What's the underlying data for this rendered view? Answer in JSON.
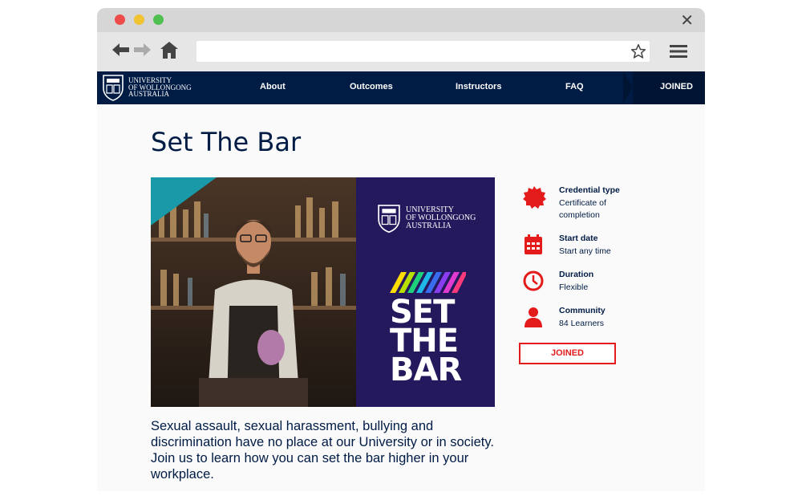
{
  "browser": {
    "url": ""
  },
  "site": {
    "logo_text": [
      "UNIVERSITY",
      "OF WOLLONGONG",
      "AUSTRALIA"
    ],
    "nav": [
      "About",
      "Outcomes",
      "Instructors",
      "FAQ"
    ],
    "joined_tab": "JOINED"
  },
  "course": {
    "title": "Set The Bar",
    "hero_logo_text": [
      "UNIVERSITY",
      "OF WOLLONGONG",
      "AUSTRALIA"
    ],
    "hero_words": [
      "SET",
      "THE",
      "BAR"
    ],
    "description": "Sexual assault, sexual harassment, bullying and discrimination have no place at our University or in society. Join us to learn how you can set the bar higher in your workplace."
  },
  "info": [
    {
      "label": "Credential type",
      "value": "Certificate of completion",
      "icon": "certificate-badge-icon"
    },
    {
      "label": "Start date",
      "value": "Start any time",
      "icon": "calendar-icon"
    },
    {
      "label": "Duration",
      "value": "Flexible",
      "icon": "clock-icon"
    },
    {
      "label": "Community",
      "value": "84 Learners",
      "icon": "person-icon"
    }
  ],
  "joined_button": "JOINED",
  "colors": {
    "navy": "#001c45",
    "accent_red": "#e31b1b",
    "hero_purple": "#25195e"
  }
}
